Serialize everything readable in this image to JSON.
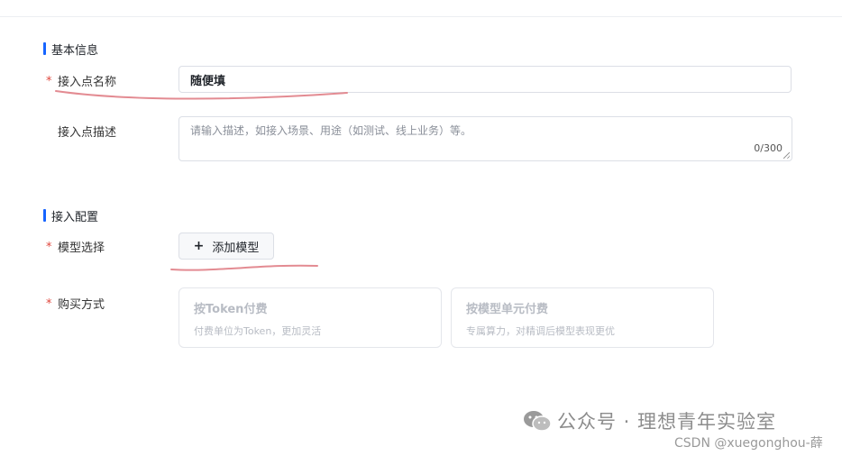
{
  "sections": {
    "basic_info_title": "基本信息",
    "access_config_title": "接入配置"
  },
  "form": {
    "required_mark": "*",
    "name_label": "接入点名称",
    "name_value": "随便填",
    "desc_label": "接入点描述",
    "desc_placeholder": "请输入描述，如接入场景、用途（如测试、线上业务）等。",
    "desc_count": "0/300",
    "model_label": "模型选择",
    "add_model_plus": "+",
    "add_model_label": "添加模型",
    "purchase_label": "购买方式",
    "purchase_options": [
      {
        "title": "按Token付费",
        "desc": "付费单位为Token，更加灵活"
      },
      {
        "title": "按模型单元付费",
        "desc": "专属算力，对精调后模型表现更优"
      }
    ]
  },
  "watermark": {
    "text": "公众号 · 理想青年实验室",
    "icon": "wechat-icon",
    "csdn": "CSDN @xuegonghou-薛"
  },
  "colors": {
    "accent": "#1664ff",
    "required": "#e0483e",
    "annotation": "#e38b92"
  }
}
